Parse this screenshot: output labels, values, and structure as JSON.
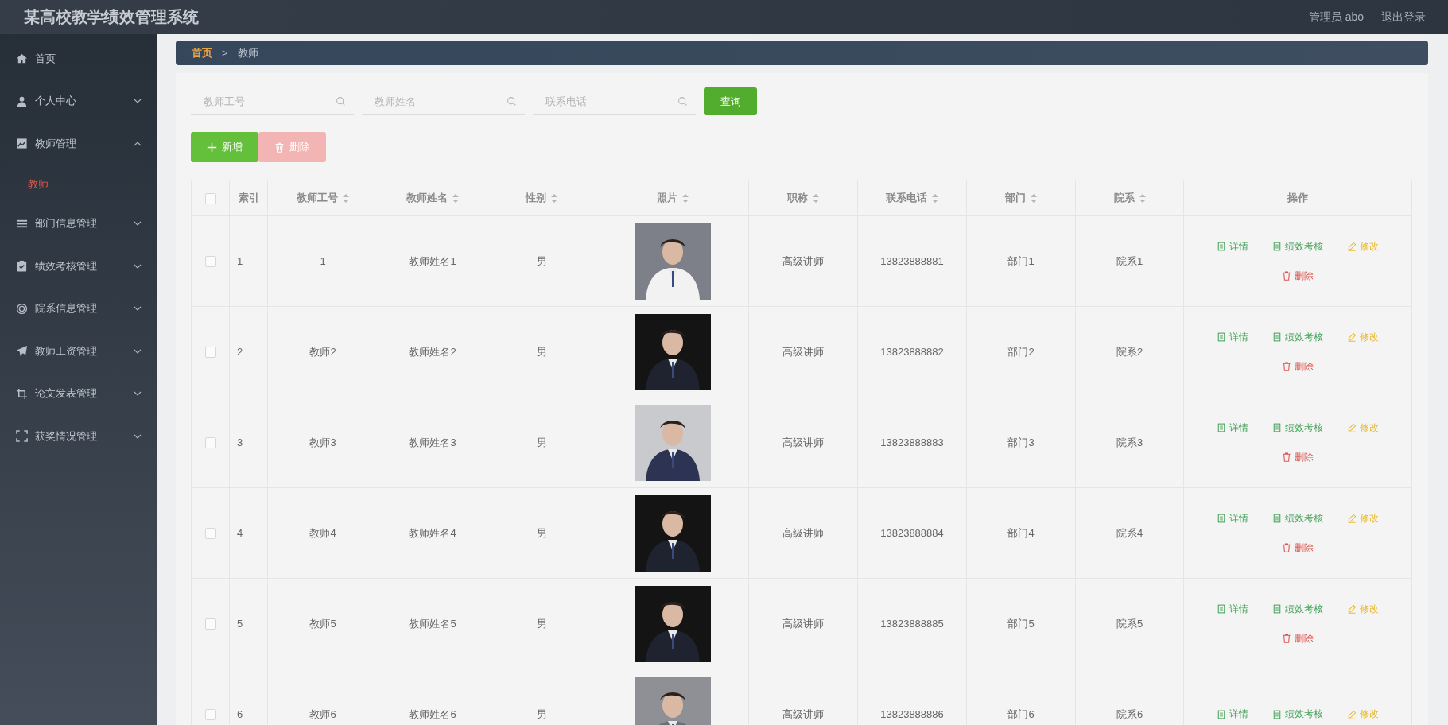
{
  "header": {
    "title": "某高校教学绩效管理系统",
    "user": "管理员 abo",
    "logout": "退出登录"
  },
  "sidebar": {
    "items": [
      {
        "label": "首页",
        "kind": "link"
      },
      {
        "label": "个人中心",
        "kind": "menu",
        "expanded": false
      },
      {
        "label": "教师管理",
        "kind": "menu",
        "expanded": true,
        "children": [
          {
            "label": "教师",
            "selected": true
          }
        ]
      },
      {
        "label": "部门信息管理",
        "kind": "menu",
        "expanded": false
      },
      {
        "label": "绩效考核管理",
        "kind": "menu",
        "expanded": false
      },
      {
        "label": "院系信息管理",
        "kind": "menu",
        "expanded": false
      },
      {
        "label": "教师工资管理",
        "kind": "menu",
        "expanded": false
      },
      {
        "label": "论文发表管理",
        "kind": "menu",
        "expanded": false
      },
      {
        "label": "获奖情况管理",
        "kind": "menu",
        "expanded": false
      }
    ]
  },
  "breadcrumb": [
    {
      "label": "首页",
      "current": false
    },
    {
      "label": "教师",
      "current": true
    }
  ],
  "breadcrumb_separator": ">",
  "search": {
    "fields": [
      {
        "placeholder": "教师工号"
      },
      {
        "placeholder": "教师姓名"
      },
      {
        "placeholder": "联系电话"
      }
    ],
    "button": "查询"
  },
  "toolbar": [
    {
      "label": "新增",
      "kind": "add",
      "disabled": false
    },
    {
      "label": "删除",
      "kind": "delete",
      "disabled": true
    }
  ],
  "table": {
    "select_all": {
      "checked": false
    },
    "columns": [
      {
        "label": "索引",
        "sortable": false
      },
      {
        "label": "教师工号",
        "sortable": true
      },
      {
        "label": "教师姓名",
        "sortable": true
      },
      {
        "label": "性别",
        "sortable": true
      },
      {
        "label": "照片",
        "sortable": true
      },
      {
        "label": "职称",
        "sortable": true
      },
      {
        "label": "联系电话",
        "sortable": true
      },
      {
        "label": "部门",
        "sortable": true
      },
      {
        "label": "院系",
        "sortable": true
      },
      {
        "label": "操作",
        "sortable": false
      }
    ],
    "rows": [
      {
        "checked": false,
        "cells": [
          "1",
          "1",
          "教师姓名1",
          "男",
          {
            "kind": "picture"
          },
          "高级讲师",
          "13823888881",
          "部门1",
          "院系1"
        ],
        "actions": [
          {
            "label": "详情",
            "kind": "detail"
          },
          {
            "label": "绩效考核",
            "kind": "review"
          },
          {
            "label": "修改",
            "kind": "edit"
          },
          {
            "label": "删除",
            "kind": "delete"
          }
        ]
      },
      {
        "checked": false,
        "cells": [
          "2",
          "教师2",
          "教师姓名2",
          "男",
          {
            "kind": "picture"
          },
          "高级讲师",
          "13823888882",
          "部门2",
          "院系2"
        ],
        "actions": [
          {
            "label": "详情",
            "kind": "detail"
          },
          {
            "label": "绩效考核",
            "kind": "review"
          },
          {
            "label": "修改",
            "kind": "edit"
          },
          {
            "label": "删除",
            "kind": "delete"
          }
        ]
      },
      {
        "checked": false,
        "cells": [
          "3",
          "教师3",
          "教师姓名3",
          "男",
          {
            "kind": "picture"
          },
          "高级讲师",
          "13823888883",
          "部门3",
          "院系3"
        ],
        "actions": [
          {
            "label": "详情",
            "kind": "detail"
          },
          {
            "label": "绩效考核",
            "kind": "review"
          },
          {
            "label": "修改",
            "kind": "edit"
          },
          {
            "label": "删除",
            "kind": "delete"
          }
        ]
      },
      {
        "checked": false,
        "cells": [
          "4",
          "教师4",
          "教师姓名4",
          "男",
          {
            "kind": "picture"
          },
          "高级讲师",
          "13823888884",
          "部门4",
          "院系4"
        ],
        "actions": [
          {
            "label": "详情",
            "kind": "detail"
          },
          {
            "label": "绩效考核",
            "kind": "review"
          },
          {
            "label": "修改",
            "kind": "edit"
          },
          {
            "label": "删除",
            "kind": "delete"
          }
        ]
      },
      {
        "checked": false,
        "cells": [
          "5",
          "教师5",
          "教师姓名5",
          "男",
          {
            "kind": "picture"
          },
          "高级讲师",
          "13823888885",
          "部门5",
          "院系5"
        ],
        "actions": [
          {
            "label": "详情",
            "kind": "detail"
          },
          {
            "label": "绩效考核",
            "kind": "review"
          },
          {
            "label": "修改",
            "kind": "edit"
          },
          {
            "label": "删除",
            "kind": "delete"
          }
        ]
      },
      {
        "checked": false,
        "cells": [
          "6",
          "教师6",
          "教师姓名6",
          "男",
          {
            "kind": "picture"
          },
          "高级讲师",
          "13823888886",
          "部门6",
          "院系6"
        ],
        "actions": [
          {
            "label": "详情",
            "kind": "detail"
          },
          {
            "label": "绩效考核",
            "kind": "review"
          },
          {
            "label": "修改",
            "kind": "edit"
          }
        ]
      }
    ]
  }
}
